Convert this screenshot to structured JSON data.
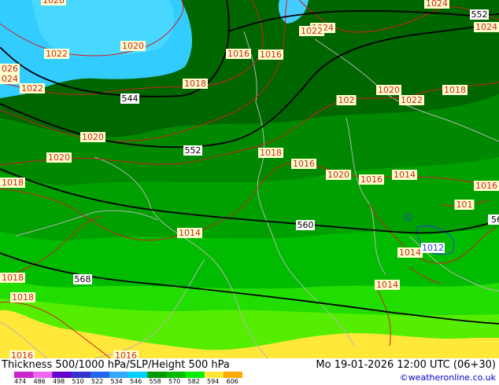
{
  "title": "Thickness 500/1000 hPa/SLP/Height 500 hPa",
  "datetime": "Mo 19-01-2026 12:00 UTC (06+30)",
  "credit": "©weatheronline.co.uk",
  "legend": {
    "ticks": [
      "474",
      "486",
      "498",
      "510",
      "522",
      "534",
      "546",
      "558",
      "570",
      "582",
      "594",
      "606"
    ],
    "colors": [
      "#cc22cc",
      "#ee66ee",
      "#6600cc",
      "#3333cc",
      "#2266ee",
      "#33aaff",
      "#00d0ff",
      "#009900",
      "#00bb00",
      "#00ee00",
      "#ffe83a",
      "#ffaa00"
    ]
  },
  "colors": {
    "height_contour": "#000000",
    "slp_contour": "#cc2222",
    "slp_low_contour": "#2244dd",
    "border": "#b0b0b0",
    "label_bg": "#ffffcc"
  },
  "height_labels": [
    {
      "text": "552",
      "contour": "552 top"
    },
    {
      "text": "544"
    },
    {
      "text": "552"
    },
    {
      "text": "560"
    },
    {
      "text": "56"
    },
    {
      "text": "568"
    }
  ],
  "slp_labels": [
    "1028",
    "1022",
    "1020",
    "026",
    "024",
    "1022",
    "1016",
    "1016",
    "1018",
    "1024",
    "1022",
    "1024",
    "1024",
    "102",
    "1020",
    "1022",
    "1018",
    "1020",
    "1020",
    "1018",
    "1018",
    "1016",
    "1020",
    "1016",
    "1014",
    "1016",
    "101",
    "1014",
    "1018",
    "1014",
    "1018",
    "1016",
    "1014",
    "1016"
  ],
  "slp_low_label": "1012"
}
